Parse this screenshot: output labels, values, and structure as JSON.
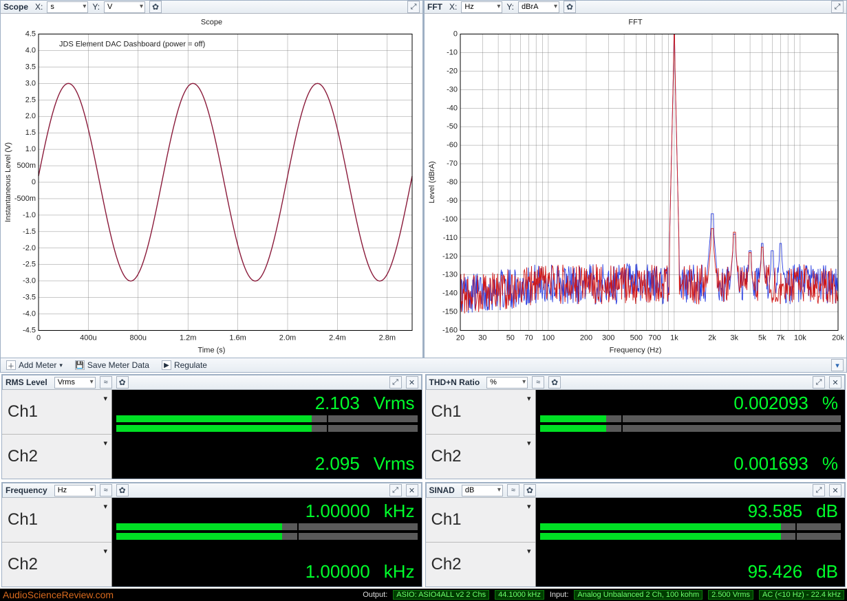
{
  "scope": {
    "title": "Scope",
    "x_label": "X:",
    "x_unit": "s",
    "y_label": "Y:",
    "y_unit": "V",
    "chart_title": "Scope",
    "annotation": "JDS Element DAC Dashboard (power = off)",
    "xlabel": "Time (s)",
    "ylabel": "Instantaneous Level (V)"
  },
  "fft": {
    "title": "FFT",
    "x_label": "X:",
    "x_unit": "Hz",
    "y_label": "Y:",
    "y_unit": "dBrA",
    "chart_title": "FFT",
    "xlabel": "Frequency (Hz)",
    "ylabel": "Level (dBrA)"
  },
  "toolbar": {
    "add_meter": "Add Meter",
    "save_meter": "Save Meter Data",
    "regulate": "Regulate"
  },
  "meters": {
    "rms": {
      "title": "RMS Level",
      "unit": "Vrms",
      "ch1_label": "Ch1",
      "ch2_label": "Ch2",
      "ch1_value": "2.103",
      "ch1_unit": "Vrms",
      "ch2_value": "2.095",
      "ch2_unit": "Vrms",
      "ch1_frac": 0.65,
      "ch2_frac": 0.65
    },
    "thdn": {
      "title": "THD+N Ratio",
      "unit": "%",
      "ch1_label": "Ch1",
      "ch2_label": "Ch2",
      "ch1_value": "0.002093",
      "ch1_unit": "%",
      "ch2_value": "0.001693",
      "ch2_unit": "%",
      "ch1_frac": 0.22,
      "ch2_frac": 0.22
    },
    "freq": {
      "title": "Frequency",
      "unit": "Hz",
      "ch1_label": "Ch1",
      "ch2_label": "Ch2",
      "ch1_value": "1.00000",
      "ch1_unit": "kHz",
      "ch2_value": "1.00000",
      "ch2_unit": "kHz",
      "ch1_frac": 0.55,
      "ch2_frac": 0.55
    },
    "sinad": {
      "title": "SINAD",
      "unit": "dB",
      "ch1_label": "Ch1",
      "ch2_label": "Ch2",
      "ch1_value": "93.585",
      "ch1_unit": "dB",
      "ch2_value": "95.426",
      "ch2_unit": "dB",
      "ch1_frac": 0.8,
      "ch2_frac": 0.8
    }
  },
  "status": {
    "watermark": "AudioScienceReview.com",
    "output_label": "Output:",
    "output_value": "ASIO: ASIO4ALL v2 2 Chs",
    "output_rate": "44.1000 kHz",
    "input_label": "Input:",
    "input_value": "Analog Unbalanced 2 Ch, 100 kohm",
    "input_level": "2.500 Vrms",
    "input_bw": "AC (<10 Hz) - 22.4 kHz"
  },
  "chart_data": [
    {
      "type": "line",
      "title": "Scope",
      "xlabel": "Time (s)",
      "ylabel": "Instantaneous Level (V)",
      "annotation": "JDS Element DAC Dashboard (power = off)",
      "xlim": [
        0,
        0.003
      ],
      "ylim": [
        -4.5,
        4.5
      ],
      "xticks_label": [
        "0",
        "400u",
        "800u",
        "1.2m",
        "1.6m",
        "2.0m",
        "2.4m",
        "2.8m"
      ],
      "xticks_value": [
        0,
        0.0004,
        0.0008,
        0.0012,
        0.0016,
        0.002,
        0.0024,
        0.0028
      ],
      "yticks_label": [
        "-4.5",
        "-4.0",
        "-3.5",
        "-3.0",
        "-2.5",
        "-2.0",
        "-1.5",
        "-1.0",
        "-500m",
        "0",
        "500m",
        "1.0",
        "1.5",
        "2.0",
        "2.5",
        "3.0",
        "3.5",
        "4.0",
        "4.5"
      ],
      "description": "Sine wave, amplitude ≈ 3.0 V, frequency ≈ 1 kHz (period ≈ 1 ms).",
      "series": [
        {
          "name": "Ch1",
          "amplitude_V": 3.0,
          "freq_Hz": 1000
        }
      ]
    },
    {
      "type": "line",
      "title": "FFT",
      "xlabel": "Frequency (Hz)",
      "ylabel": "Level (dBrA)",
      "x_scale": "log",
      "xlim": [
        20,
        20000
      ],
      "ylim": [
        -160,
        0
      ],
      "xticks_label": [
        "20",
        "30",
        "50",
        "70",
        "100",
        "200",
        "300",
        "500",
        "700",
        "1k",
        "2k",
        "3k",
        "5k",
        "7k",
        "10k",
        "20k"
      ],
      "yticks_value": [
        0,
        -10,
        -20,
        -30,
        -40,
        -50,
        -60,
        -70,
        -80,
        -90,
        -100,
        -110,
        -120,
        -130,
        -140,
        -150,
        -160
      ],
      "noise_floor_approx_dBrA": -135,
      "series": [
        {
          "name": "Ch1 (blue)",
          "peaks": [
            {
              "f_Hz": 1000,
              "level_dBrA": 0
            }
          ],
          "harmonics": [
            {
              "f_Hz": 2000,
              "level_dBrA": -97
            },
            {
              "f_Hz": 3000,
              "level_dBrA": -108
            },
            {
              "f_Hz": 4000,
              "level_dBrA": -117
            },
            {
              "f_Hz": 5000,
              "level_dBrA": -113
            },
            {
              "f_Hz": 6000,
              "level_dBrA": -117
            },
            {
              "f_Hz": 7000,
              "level_dBrA": -113
            }
          ]
        },
        {
          "name": "Ch2 (red)",
          "peaks": [
            {
              "f_Hz": 1000,
              "level_dBrA": 0
            }
          ],
          "harmonics": [
            {
              "f_Hz": 2000,
              "level_dBrA": -105
            },
            {
              "f_Hz": 3000,
              "level_dBrA": -107
            },
            {
              "f_Hz": 4000,
              "level_dBrA": -118
            },
            {
              "f_Hz": 5000,
              "level_dBrA": -115
            }
          ]
        }
      ]
    }
  ]
}
